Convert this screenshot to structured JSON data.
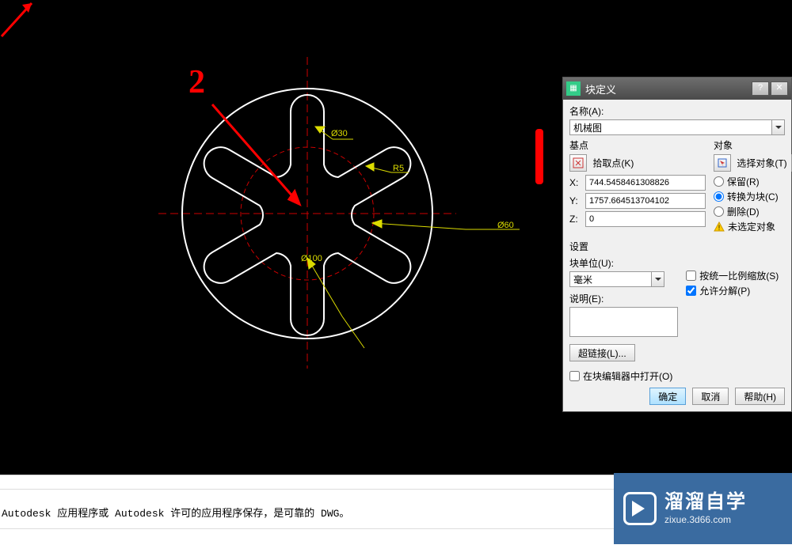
{
  "annotations": {
    "marker1": "",
    "marker2": "2"
  },
  "drawing": {
    "dim_phi30": "Ø30",
    "dim_R5": "R5",
    "dim_phi60": "Ø60",
    "dim_phi100": "Ø100"
  },
  "dialog": {
    "title": "块定义",
    "help_btn": "?",
    "close_btn": "",
    "name_label": "名称(A):",
    "name_value": "机械图",
    "basepoint_title": "基点",
    "pickpoint_label": "拾取点(K)",
    "x_label": "X:",
    "y_label": "Y:",
    "z_label": "Z:",
    "x_value": "744.5458461308826",
    "y_value": "1757.664513704102",
    "z_value": "0",
    "objects_title": "对象",
    "selectobjects_label": "选择对象(T)",
    "radio_retain": "保留(R)",
    "radio_convert": "转换为块(C)",
    "radio_delete": "删除(D)",
    "no_selection": "未选定对象",
    "settings_title": "设置",
    "blockunit_label": "块单位(U):",
    "blockunit_value": "毫米",
    "scale_uniform": "按统一比例缩放(S)",
    "allow_explode": "允许分解(P)",
    "desc_label": "说明(E):",
    "desc_value": "",
    "hyperlink_btn": "超链接(L)...",
    "open_in_editor": "在块编辑器中打开(O)",
    "ok_btn": "确定",
    "cancel_btn": "取消",
    "help_footer_btn": "帮助(H)"
  },
  "status": {
    "line1": "Autodesk 应用程序或 Autodesk 许可的应用程序保存，是可靠的 DWG。"
  },
  "watermark": {
    "big": "溜溜自学",
    "small": "zixue.3d66.com"
  }
}
